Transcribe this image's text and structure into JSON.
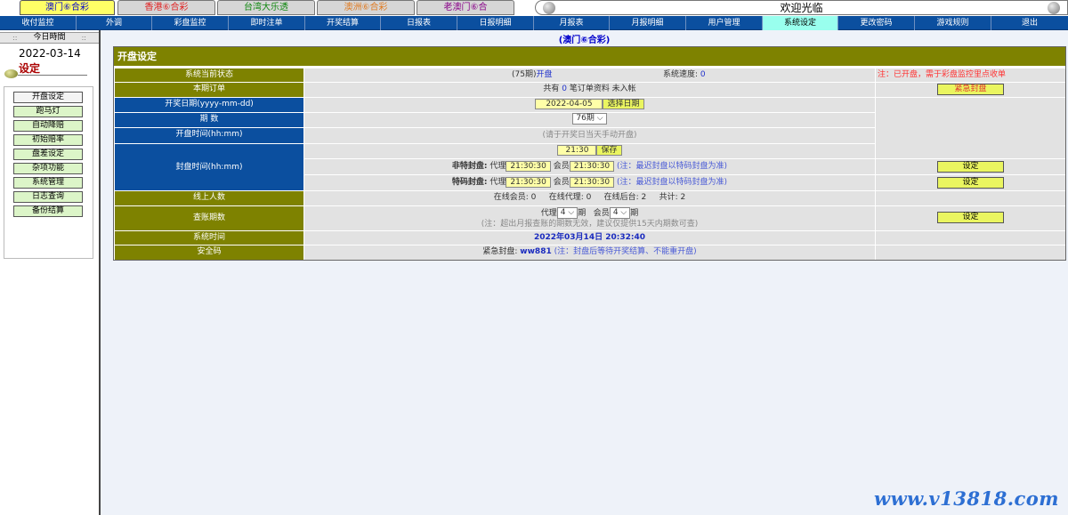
{
  "lottery_tabs": [
    "澳门⑥合彩",
    "香港⑥合彩",
    "台湾大乐透",
    "澳洲⑥合彩",
    "老澳门⑥合"
  ],
  "welcome": "欢迎光临",
  "nav": [
    "收付监控",
    "外调",
    "彩盘监控",
    "即时注单",
    "开奖结算",
    "日报表",
    "日报明细",
    "月报表",
    "月报明细",
    "用户管理",
    "系统设定",
    "更改密码",
    "游戏规则",
    "退出"
  ],
  "sidebar": {
    "header": "今日時間",
    "date": "2022-03-14",
    "title": "设定",
    "items": [
      "开盘设定",
      "跑马灯",
      "自动降赔",
      "初始赔率",
      "盘差设定",
      "杂项功能",
      "系统管理",
      "日志查询",
      "备份结算"
    ]
  },
  "main_title": "(澳门⑥合彩)",
  "panel": {
    "title": "开盘设定",
    "status": {
      "label": "系统当前状态",
      "period": "(75期)",
      "state": "开盘",
      "speed_label": "系统速度:",
      "speed_value": "0",
      "note": "注：已开盘，需于彩盘监控里点收单"
    },
    "orders": {
      "label": "本期订单",
      "prefix": "共有",
      "count": "0",
      "suffix": "笔订单资料 未入帐",
      "button": "紧急封盘"
    },
    "draw_date": {
      "label": "开奖日期(yyyy-mm-dd)",
      "value": "2022-04-05",
      "button": "选择日期"
    },
    "period": {
      "label": "期 数",
      "value": "76期"
    },
    "open_time": {
      "label": "开盘时间(hh:mm)",
      "note": "(请于开奖日当天手动开盘)"
    },
    "close_time": {
      "label": "封盘时间(hh:mm)",
      "value": "21:30",
      "save_button": "保存",
      "non_special": {
        "label": "非特封盘:",
        "agent_label": "代理",
        "agent_value": "21:30:30",
        "member_label": "会员",
        "member_value": "21:30:30",
        "note": "(注：最迟封盘以特码封盘为准)",
        "button": "设定"
      },
      "special": {
        "label": "特码封盘:",
        "agent_label": "代理",
        "agent_value": "21:30:30",
        "member_label": "会员",
        "member_value": "21:30:30",
        "note": "(注：最迟封盘以特码封盘为准)",
        "button": "设定"
      }
    },
    "online": {
      "label": "线上人数",
      "members": "在线会员: 0",
      "agents": "在线代理: 0",
      "backend": "在线后台: 2",
      "total": "共计: 2"
    },
    "query_period": {
      "label": "查账期数",
      "agent_label": "代理",
      "agent_value": "4",
      "agent_unit": "期",
      "member_label": "会员",
      "member_value": "4",
      "member_unit": "期",
      "note": "(注：超出月报查账的期数无效，建议仅提供15天内期数可查)",
      "button": "设定"
    },
    "system_time": {
      "label": "系统时间",
      "value": "2022年03月14日 20:32:40"
    },
    "security": {
      "label": "安全码",
      "prefix": "紧急封盘:",
      "code": "ww881",
      "note": "(注：封盘后等待开奖结算、不能重开盘)"
    }
  },
  "watermark": "www.v13818.com",
  "colors": {
    "nav_blue": "#0b4f9f",
    "olive": "#7e8200",
    "active_tab": "#ffff66",
    "active_nav": "#99ffee",
    "button_yellow": "#eaf560"
  }
}
